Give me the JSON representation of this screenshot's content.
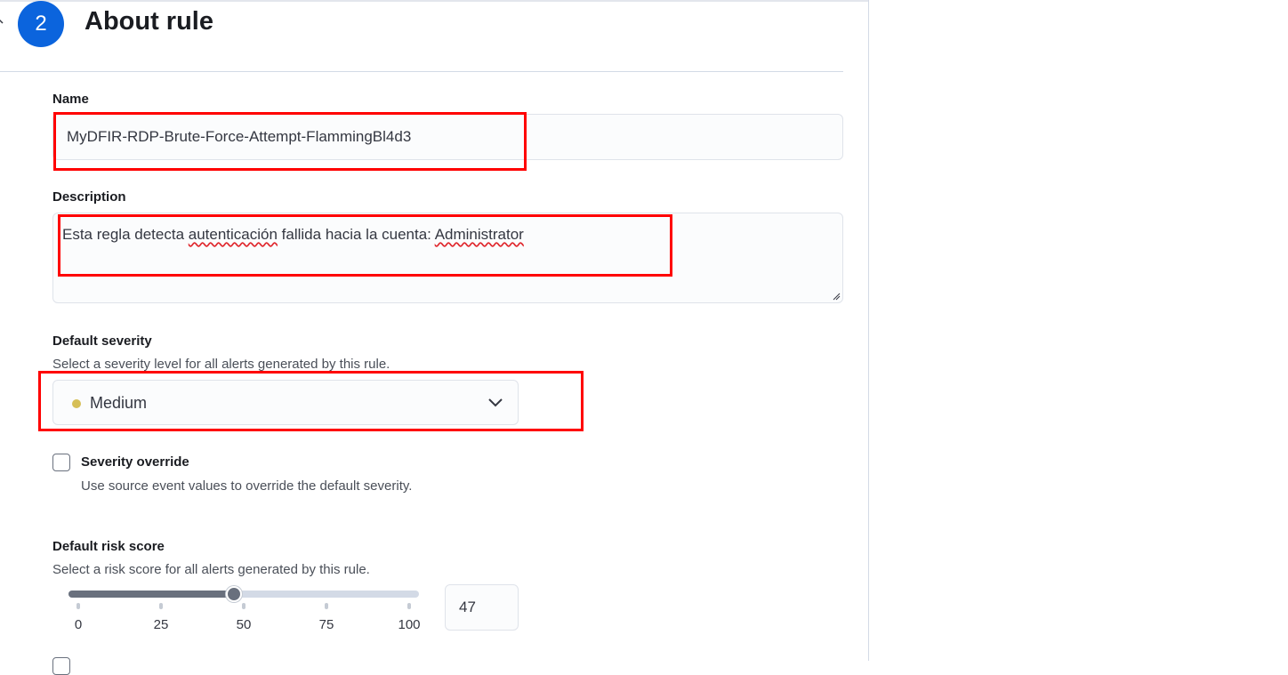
{
  "step": {
    "number": "2",
    "title": "About rule"
  },
  "name_field": {
    "label": "Name",
    "value": "MyDFIR-RDP-Brute-Force-Attempt-FlammingBl4d3"
  },
  "description_field": {
    "label": "Description",
    "text_part1": "Esta regla detecta ",
    "text_misspelled1": "autenticación",
    "text_part2": " fallida hacia la cuenta: ",
    "text_misspelled2": "Administrator"
  },
  "severity": {
    "label": "Default severity",
    "help": "Select a severity level for all alerts generated by this rule.",
    "selected": "Medium",
    "dot_color": "#d6bf57"
  },
  "severity_override": {
    "label": "Severity override",
    "help": "Use source event values to override the default severity.",
    "checked": false
  },
  "risk_score": {
    "label": "Default risk score",
    "help": "Select a risk score for all alerts generated by this rule.",
    "value": "47",
    "min": 0,
    "max": 100,
    "ticks": [
      "0",
      "25",
      "50",
      "75",
      "100"
    ]
  },
  "colors": {
    "accent": "#0b64dd",
    "highlight": "#ff0000"
  }
}
